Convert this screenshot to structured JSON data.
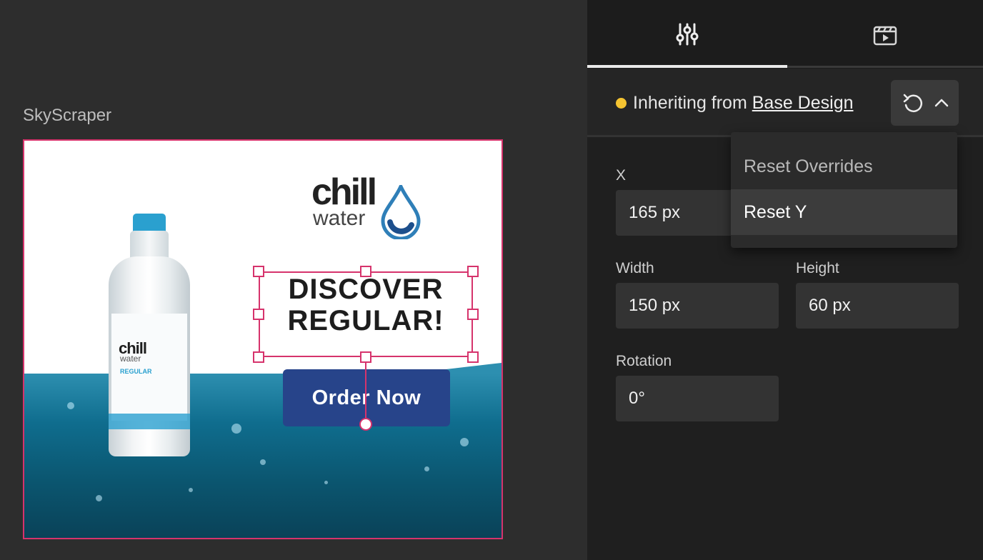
{
  "canvas": {
    "frame_label": "SkyScraper",
    "ad": {
      "logo_word": "chill",
      "logo_sub": "water",
      "bottle_brand": "chill",
      "bottle_sub": "water",
      "bottle_variant": "REGULAR",
      "headline_line1": "DISCOVER",
      "headline_line2": "REGULAR!",
      "cta": "Order Now"
    },
    "colors": {
      "selection": "#d6336c",
      "cta_bg": "#27448a"
    }
  },
  "panel": {
    "tabs": [
      {
        "icon": "sliders-icon",
        "active": true
      },
      {
        "icon": "clapperboard-icon",
        "active": false
      }
    ],
    "inherit": {
      "prefix": "Inheriting from ",
      "link": "Base Design",
      "status_color": "#f5c431"
    },
    "reset_menu": {
      "items": [
        "Reset Overrides",
        "Reset Y"
      ],
      "highlighted": "Reset Y"
    },
    "fields": {
      "x_label": "X",
      "x_value": "165 px",
      "width_label": "Width",
      "width_value": "150 px",
      "height_label": "Height",
      "height_value": "60 px",
      "rotation_label": "Rotation",
      "rotation_value": "0°"
    }
  }
}
